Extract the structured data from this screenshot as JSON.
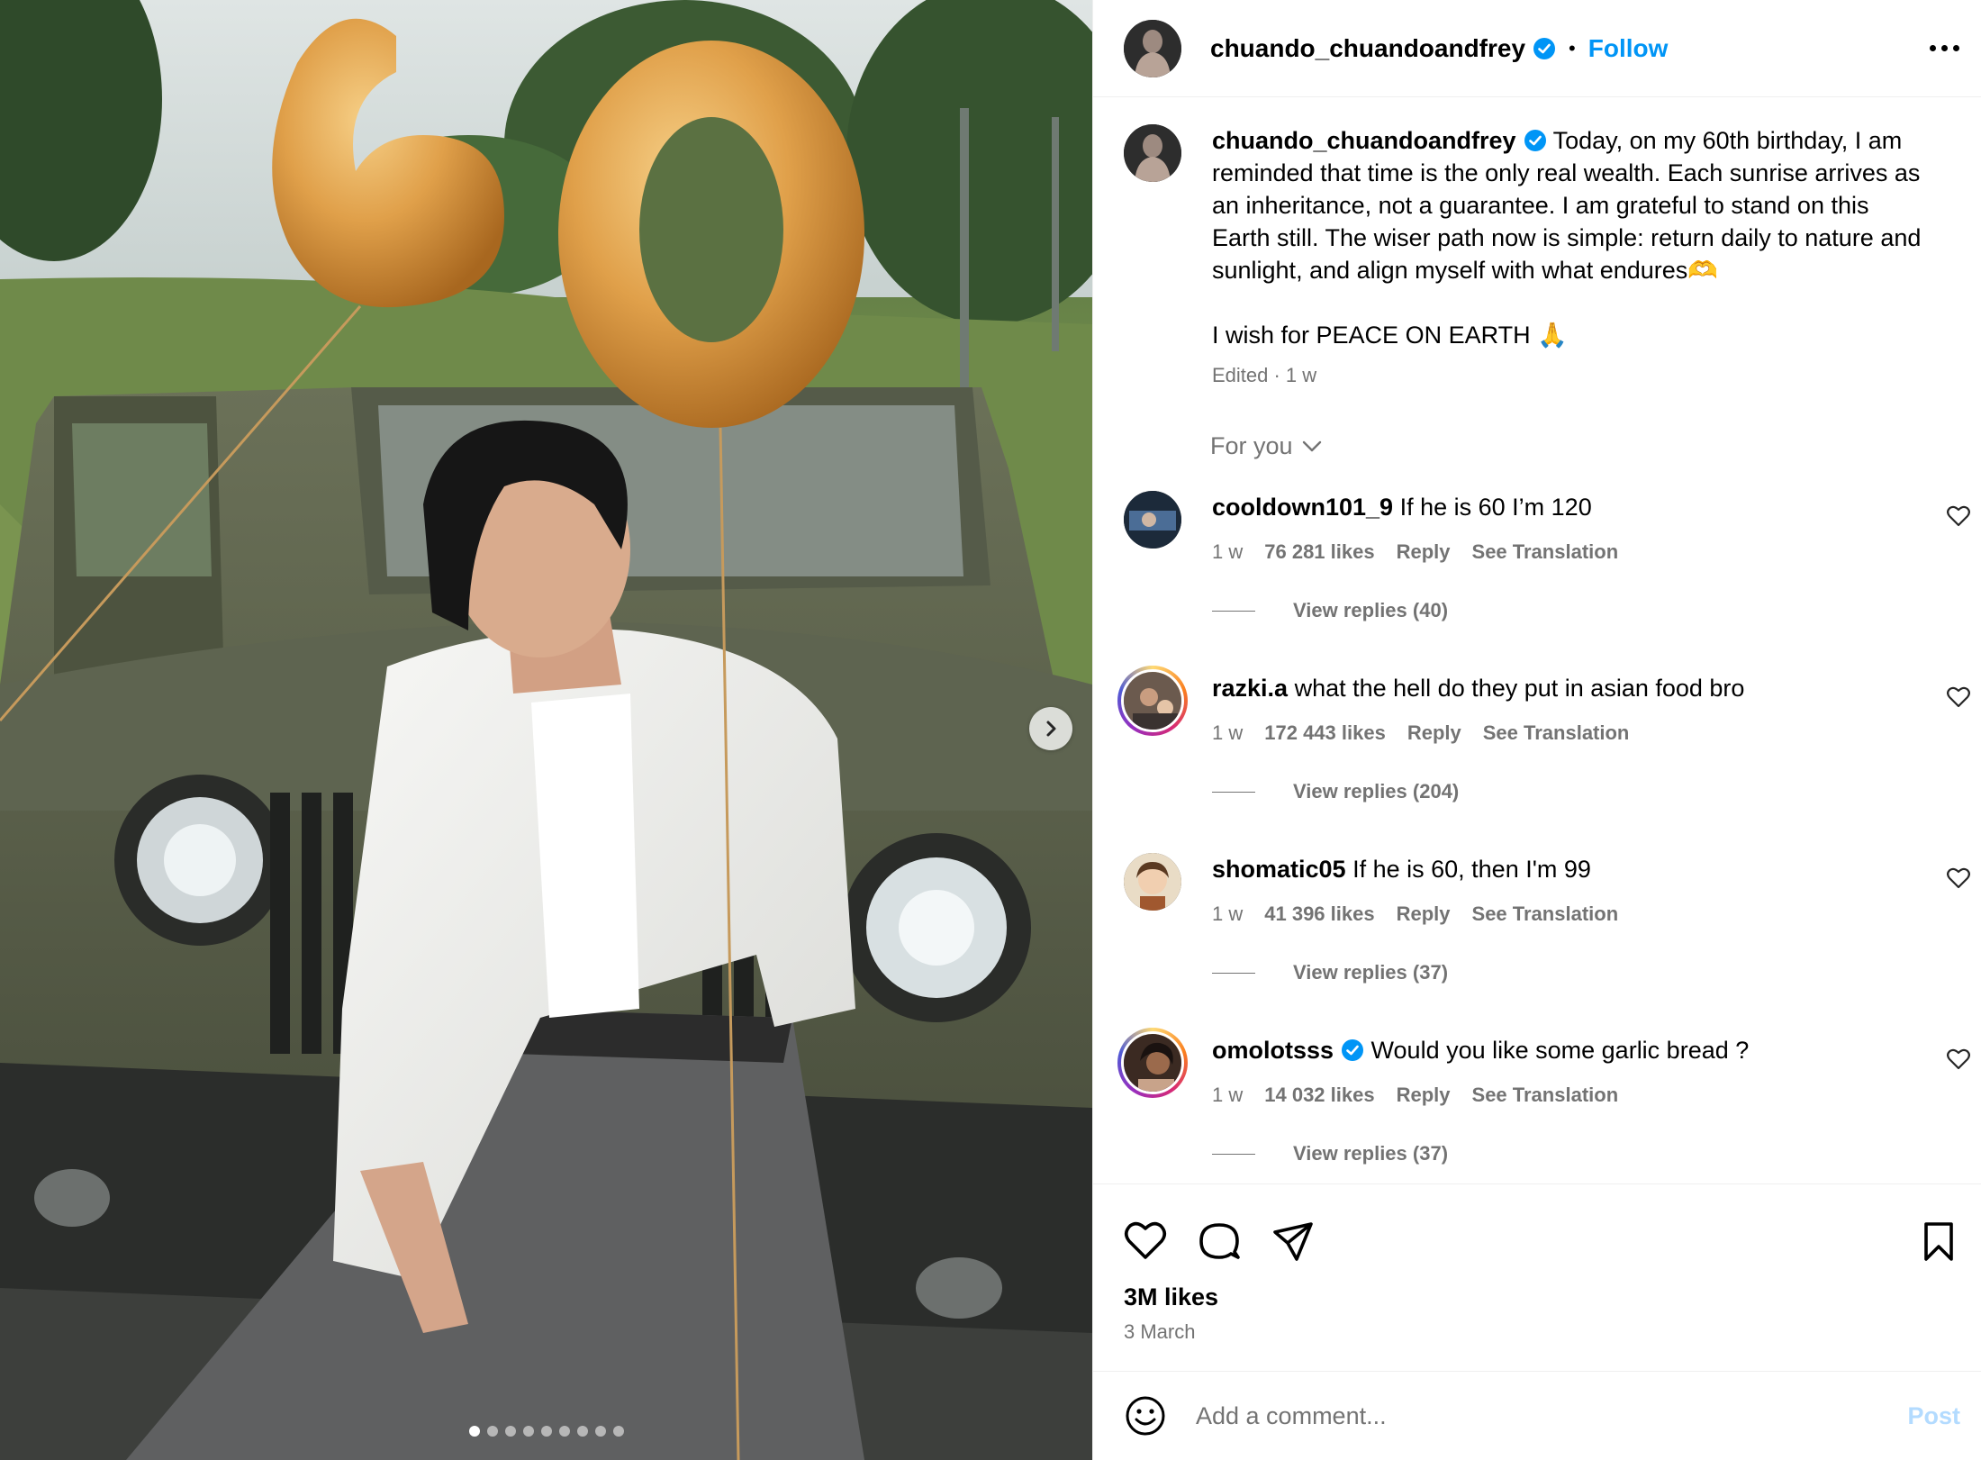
{
  "post": {
    "username": "chuando_chuandoandfrey",
    "follow_label": "Follow",
    "separator": "•",
    "caption_para1": "Today, on my 60th birthday, I am reminded that time is the only real wealth. Each sunrise arrives as an inheritance, not a guarantee. I am grateful to stand on this Earth still. The wiser path now is simple: return daily to nature and sunlight, and align myself with what endures🫶",
    "caption_para2": "I wish for PEACE ON EARTH 🙏",
    "caption_meta": "Edited · 1 w",
    "likes": "3M likes",
    "date": "3 March",
    "carousel_total": 9,
    "carousel_index": 1
  },
  "media": {
    "balloon_text": "60"
  },
  "comments_header": {
    "for_you": "For you"
  },
  "comments": [
    {
      "username": "cooldown101_9",
      "text": "If he is 60 I’m 120",
      "age": "1 w",
      "likes": "76 281 likes",
      "reply": "Reply",
      "translate": "See Translation",
      "replies": "View replies (40)"
    },
    {
      "username": "razki.a",
      "text": "what the hell do they put in asian food bro",
      "age": "1 w",
      "likes": "172 443 likes",
      "reply": "Reply",
      "translate": "See Translation",
      "replies": "View replies (204)"
    },
    {
      "username": "shomatic05",
      "text": "If he is 60, then I'm 99",
      "age": "1 w",
      "likes": "41 396 likes",
      "reply": "Reply",
      "translate": "See Translation",
      "replies": "View replies (37)"
    },
    {
      "username": "omolotsss",
      "text": "Would you like some garlic bread ?",
      "age": "1 w",
      "likes": "14 032 likes",
      "reply": "Reply",
      "translate": "See Translation",
      "replies": "View replies (37)"
    }
  ],
  "comment_box": {
    "placeholder": "Add a comment...",
    "post_label": "Post"
  },
  "colors": {
    "accent": "#0095f6",
    "muted": "#737373",
    "post_disabled": "#b3dbff",
    "balloon_gold": "#e0a04a"
  }
}
